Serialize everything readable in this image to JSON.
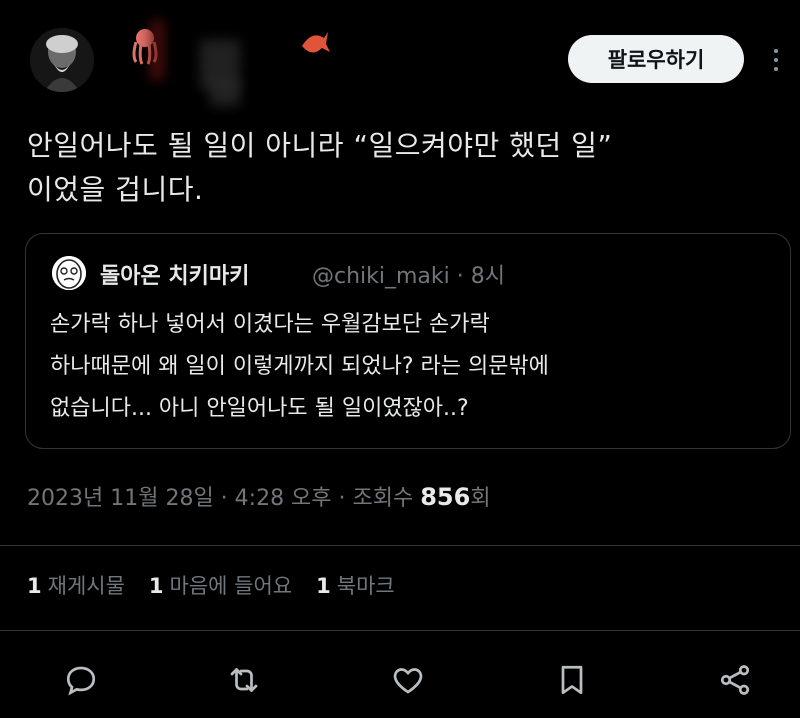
{
  "header": {
    "follow_label": "팔로우하기"
  },
  "tweet": {
    "text_lines": [
      "안일어나도 될 일이 아니라 “일으켜야만 했던 일”",
      "이었을 겁니다."
    ]
  },
  "quote": {
    "name": "돌아온 치키마키",
    "handle": "@chiki_maki · 8시",
    "text_lines": [
      "손가락 하나 넣어서 이겼다는 우월감보단 손가락",
      "하나때문에 왜 일이 이렇게까지 되었나? 라는 의문밖에",
      "없습니다... 아니 안일어나도 될 일이였잖아..?"
    ]
  },
  "meta": {
    "timestamp": "2023년 11월 28일 · 4:28 오후 · 조회수 ",
    "views": "856",
    "views_suffix": "회"
  },
  "stats": {
    "reposts_count": "1",
    "reposts_label": "재게시물",
    "likes_count": "1",
    "likes_label": "마음에 들어요",
    "bookmarks_count": "1",
    "bookmarks_label": "북마크"
  },
  "actions": [
    "reply-icon",
    "repost-icon",
    "like-icon",
    "bookmark-icon",
    "share-icon"
  ],
  "colors": {
    "background": "#000000",
    "text": "#e7e9ea",
    "muted": "#71767b",
    "border": "#2f3336",
    "follow_bg": "#eff3f4"
  }
}
